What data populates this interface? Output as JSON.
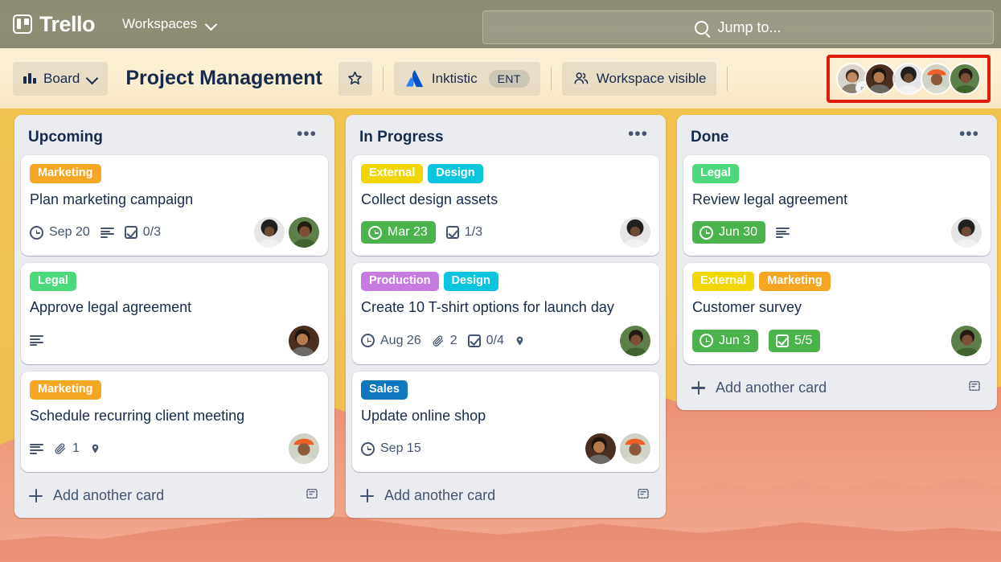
{
  "topnav": {
    "brand": "Trello",
    "workspaces_label": "Workspaces",
    "search_placeholder": "Jump to...",
    "search_value": "Jump to..."
  },
  "boardbar": {
    "view_label": "Board",
    "title": "Project Management",
    "star_label": "★",
    "workspace_name": "Inktistic",
    "workspace_badge": "ENT",
    "visibility_label": "Workspace visible",
    "highlight_color": "#e31b0c",
    "members": [
      {
        "name": "member-1",
        "badge": "»"
      },
      {
        "name": "member-2",
        "badge": ""
      },
      {
        "name": "member-3",
        "badge": ""
      },
      {
        "name": "member-4",
        "badge": ""
      },
      {
        "name": "member-5",
        "badge": ""
      }
    ]
  },
  "palette": {
    "label_marketing": "#f5a623",
    "label_legal": "#4cd97b",
    "label_external": "#f2d600",
    "label_design": "#0bc4de",
    "label_production": "#c77ae0",
    "label_sales": "#0f77bd",
    "due_green": "#4bb34b",
    "list_bg": "#ebecf0",
    "card_bg": "#ffffff",
    "text_dark": "#172b4d",
    "text_muted": "#44546f"
  },
  "lists": [
    {
      "title": "Upcoming",
      "menu": "•••",
      "add_card_label": "Add another card",
      "cards": [
        {
          "title": "Plan marketing campaign",
          "labels": [
            {
              "text": "Marketing",
              "color": "#f5a623"
            }
          ],
          "due": {
            "text": "Sep 20",
            "highlight": false
          },
          "description": true,
          "attachments": null,
          "checklist": {
            "text": "0/3",
            "highlight": false
          },
          "location": false,
          "avatars": 2
        },
        {
          "title": "Approve legal agreement",
          "labels": [
            {
              "text": "Legal",
              "color": "#4cd97b"
            }
          ],
          "due": null,
          "description": true,
          "attachments": null,
          "checklist": null,
          "location": false,
          "avatars": 1
        },
        {
          "title": "Schedule recurring client meeting",
          "labels": [
            {
              "text": "Marketing",
              "color": "#f5a623"
            }
          ],
          "due": null,
          "description": true,
          "attachments": "1",
          "checklist": null,
          "location": true,
          "avatars": 1
        }
      ]
    },
    {
      "title": "In Progress",
      "menu": "•••",
      "add_card_label": "Add another card",
      "cards": [
        {
          "title": "Collect design assets",
          "labels": [
            {
              "text": "External",
              "color": "#f2d600"
            },
            {
              "text": "Design",
              "color": "#0bc4de"
            }
          ],
          "due": {
            "text": "Mar 23",
            "highlight": true
          },
          "description": false,
          "attachments": null,
          "checklist": {
            "text": "1/3",
            "highlight": false
          },
          "location": false,
          "avatars": 1
        },
        {
          "title": "Create 10 T-shirt options for launch day",
          "labels": [
            {
              "text": "Production",
              "color": "#c77ae0"
            },
            {
              "text": "Design",
              "color": "#0bc4de"
            }
          ],
          "due": {
            "text": "Aug 26",
            "highlight": false
          },
          "description": false,
          "attachments": "2",
          "checklist": {
            "text": "0/4",
            "highlight": false
          },
          "location": true,
          "avatars": 1
        },
        {
          "title": "Update online shop",
          "labels": [
            {
              "text": "Sales",
              "color": "#0f77bd"
            }
          ],
          "due": {
            "text": "Sep 15",
            "highlight": false
          },
          "description": false,
          "attachments": null,
          "checklist": null,
          "location": false,
          "avatars": 2
        }
      ]
    },
    {
      "title": "Done",
      "menu": "•••",
      "add_card_label": "Add another card",
      "cards": [
        {
          "title": "Review legal agreement",
          "labels": [
            {
              "text": "Legal",
              "color": "#4cd97b"
            }
          ],
          "due": {
            "text": "Jun 30",
            "highlight": true
          },
          "description": true,
          "attachments": null,
          "checklist": null,
          "location": false,
          "avatars": 1
        },
        {
          "title": "Customer survey",
          "labels": [
            {
              "text": "External",
              "color": "#f2d600"
            },
            {
              "text": "Marketing",
              "color": "#f5a623"
            }
          ],
          "due": {
            "text": "Jun 3",
            "highlight": true
          },
          "description": false,
          "attachments": null,
          "checklist": {
            "text": "5/5",
            "highlight": true
          },
          "location": false,
          "avatars": 1
        }
      ]
    }
  ]
}
